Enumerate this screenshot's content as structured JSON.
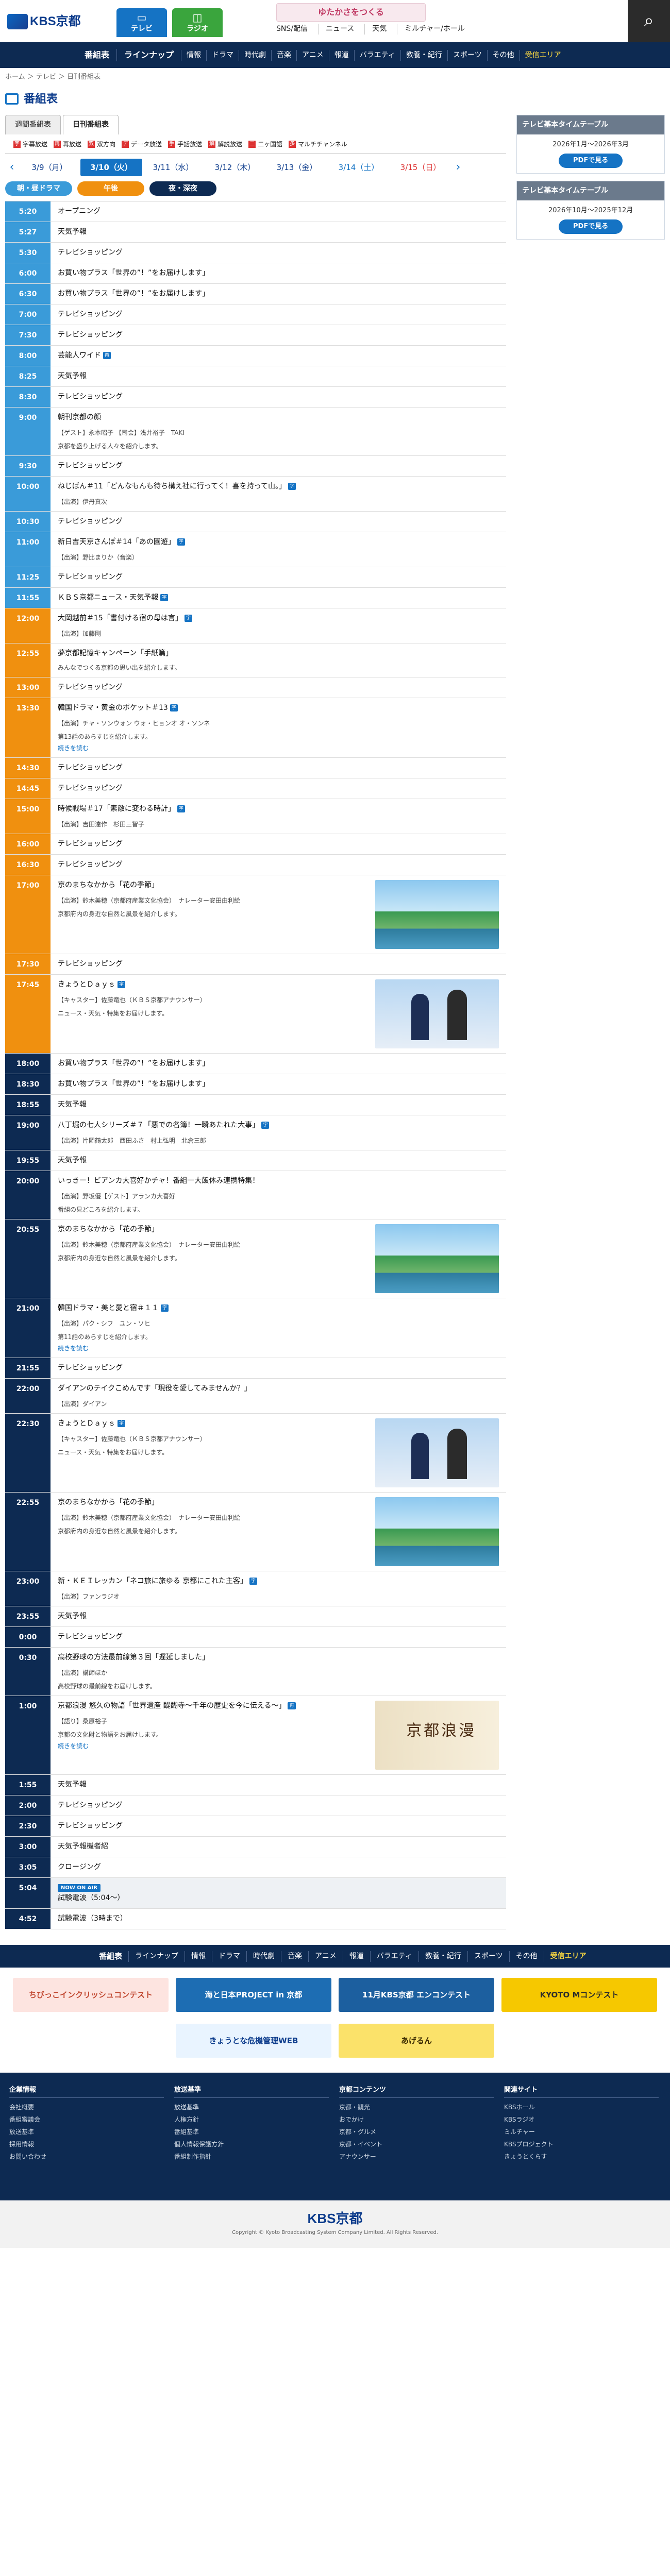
{
  "header": {
    "logo": "KBS京都",
    "tv_label": "テレビ",
    "radio_label": "ラジオ",
    "banner_text": "ゆたかさをつくる",
    "links": [
      "SNS/配信",
      "ニュース",
      "天気",
      "ミルチャー/ホール"
    ],
    "search_icon": "search-icon"
  },
  "gnav": [
    "番組表",
    "ラインナップ",
    "情報",
    "ドラマ",
    "時代劇",
    "音楽",
    "アニメ",
    "報道",
    "バラエティ",
    "教養・紀行",
    "スポーツ",
    "その他",
    "受信エリア"
  ],
  "breadcrumb": "ホーム ＞ テレビ ＞ 日刊番組表",
  "page_title": "番組表",
  "tabs": [
    "週間番組表",
    "日刊番組表"
  ],
  "legend": [
    {
      "mark": "字",
      "label": "字幕放送"
    },
    {
      "mark": "再",
      "label": "再放送"
    },
    {
      "mark": "双",
      "label": "双方向"
    },
    {
      "mark": "デ",
      "label": "データ放送"
    },
    {
      "mark": "手",
      "label": "手話放送"
    },
    {
      "mark": "解",
      "label": "解説放送"
    },
    {
      "mark": "二",
      "label": "二ヶ国語"
    },
    {
      "mark": "多",
      "label": "マルチチャンネル"
    }
  ],
  "dates": [
    {
      "label": "3/9（月）",
      "kind": ""
    },
    {
      "label": "3/10（火）",
      "kind": "on"
    },
    {
      "label": "3/11（水）",
      "kind": ""
    },
    {
      "label": "3/12（木）",
      "kind": ""
    },
    {
      "label": "3/13（金）",
      "kind": ""
    },
    {
      "label": "3/14（土）",
      "kind": "sat"
    },
    {
      "label": "3/15（日）",
      "kind": "sun"
    }
  ],
  "jumps": [
    "朝・昼ドラマ",
    "午後",
    "夜・深夜"
  ],
  "schedule": [
    {
      "time": "5:20",
      "zone": "morning",
      "title": "オープニング"
    },
    {
      "time": "5:27",
      "zone": "morning",
      "title": "天気予報"
    },
    {
      "time": "5:30",
      "zone": "morning",
      "title": "テレビショッピング"
    },
    {
      "time": "6:00",
      "zone": "morning",
      "title": "お買い物プラス「世界の”！”をお届けします」"
    },
    {
      "time": "6:30",
      "zone": "morning",
      "title": "お買い物プラス「世界の”！”をお届けします」"
    },
    {
      "time": "7:00",
      "zone": "morning",
      "title": "テレビショッピング"
    },
    {
      "time": "7:30",
      "zone": "morning",
      "title": "テレビショッピング"
    },
    {
      "time": "8:00",
      "zone": "morning",
      "title": "芸能人ワイド",
      "badge": "再"
    },
    {
      "time": "8:25",
      "zone": "morning",
      "title": "天気予報"
    },
    {
      "time": "8:30",
      "zone": "morning",
      "title": "テレビショッピング"
    },
    {
      "time": "9:00",
      "zone": "morning",
      "title": "朝刊京都の顔",
      "cast": "【ゲスト】永本昭子 【司会】浅井裕子　TAKI",
      "desc": "京都を盛り上げる人々を紹介します。"
    },
    {
      "time": "9:30",
      "zone": "morning",
      "title": "テレビショッピング"
    },
    {
      "time": "10:00",
      "zone": "morning",
      "title": "ねじばん＃11「どんなもんも待ち構え社に行ってく！喜を持って山。」",
      "badge": "字",
      "cast": "【出演】伊丹真次"
    },
    {
      "time": "10:30",
      "zone": "morning",
      "title": "テレビショッピング"
    },
    {
      "time": "11:00",
      "zone": "morning",
      "title": "新日吉天京さんぽ＃14「あの園遊」",
      "badge": "字",
      "cast": "【出演】野比まりか（音楽）"
    },
    {
      "time": "11:25",
      "zone": "morning",
      "title": "テレビショッピング"
    },
    {
      "time": "11:55",
      "zone": "morning",
      "title": "ＫＢＳ京都ニュース・天気予報",
      "badge": "字"
    },
    {
      "time": "12:00",
      "zone": "day",
      "title": "大岡越前＃15「書付ける宿の母は言」",
      "badge": "字",
      "cast": "【出演】加藤剛"
    },
    {
      "time": "12:55",
      "zone": "day",
      "title": "夢京都記憶キャンペーン「手紙篇」",
      "desc": "みんなでつくる京都の思い出を紹介します。"
    },
    {
      "time": "13:00",
      "zone": "day",
      "title": "テレビショッピング"
    },
    {
      "time": "13:30",
      "zone": "day",
      "title": "韓国ドラマ・黄金のポケット＃13",
      "badge": "字",
      "cast": "【出演】チャ・ソンウォン ウォ・ヒョンオ オ・ソンネ",
      "desc": "第13話のあらすじを紹介します。",
      "more": "続きを読む"
    },
    {
      "time": "14:30",
      "zone": "day",
      "title": "テレビショッピング"
    },
    {
      "time": "14:45",
      "zone": "day",
      "title": "テレビショッピング"
    },
    {
      "time": "15:00",
      "zone": "day",
      "title": "時候戦場＃17「素敵に変わる時計」",
      "badge": "字",
      "cast": "【出演】吉田達作　杉田三智子"
    },
    {
      "time": "16:00",
      "zone": "day",
      "title": "テレビショッピング"
    },
    {
      "time": "16:30",
      "zone": "day",
      "title": "テレビショッピング"
    },
    {
      "time": "17:00",
      "zone": "day",
      "title": "京のまちなかから「花の季節」",
      "cast": "【出演】鈴木美穂（京都府産業文化協会）　ナレーター安田由利絵",
      "desc": "京都府内の身近な自然と風景を紹介します。",
      "thumb": "river"
    },
    {
      "time": "17:30",
      "zone": "day",
      "title": "テレビショッピング"
    },
    {
      "time": "17:45",
      "zone": "day",
      "title": "きょうとＤａｙｓ",
      "badge": "字",
      "cast": "【キャスター】佐藤竜也（ＫＢＳ京都アナウンサー）",
      "desc": "ニュース・天気・特集をお届けします。",
      "thumb": "news"
    },
    {
      "time": "18:00",
      "zone": "night",
      "title": "お買い物プラス「世界の”！”をお届けします」"
    },
    {
      "time": "18:30",
      "zone": "night",
      "title": "お買い物プラス「世界の”！”をお届けします」"
    },
    {
      "time": "18:55",
      "zone": "night",
      "title": "天気予報"
    },
    {
      "time": "19:00",
      "zone": "night",
      "title": "八丁堀の七人シリーズ＃７「悪での名簿！一瞬あたれた大事」",
      "badge": "字",
      "cast": "【出演】片岡鶴太郎　西田ふさ　村上弘明　北倉三郎"
    },
    {
      "time": "19:55",
      "zone": "night",
      "title": "天気予報"
    },
    {
      "time": "20:00",
      "zone": "night",
      "title": "いっきー！ビアンカ大喜好かチャ！番組一大飯休み連携特集！",
      "cast": "【出演】野坂優【ゲスト】アランカ大喜好",
      "desc": "番組の見どころを紹介します。"
    },
    {
      "time": "20:55",
      "zone": "night",
      "title": "京のまちなかから「花の季節」",
      "cast": "【出演】鈴木美穂（京都府産業文化協会）　ナレーター安田由利絵",
      "desc": "京都府内の身近な自然と風景を紹介します。",
      "thumb": "river"
    },
    {
      "time": "21:00",
      "zone": "night",
      "title": "韓国ドラマ・美と愛と宿＃１１",
      "badge": "字",
      "cast": "【出演】パク・シフ　ユン・ソヒ",
      "desc": "第11話のあらすじを紹介します。",
      "more": "続きを読む"
    },
    {
      "time": "21:55",
      "zone": "night",
      "title": "テレビショッピング"
    },
    {
      "time": "22:00",
      "zone": "night",
      "title": "ダイアンのテイクこめんです「現役を愛してみませんか？」",
      "cast": "【出演】ダイアン"
    },
    {
      "time": "22:30",
      "zone": "night",
      "title": "きょうとＤａｙｓ",
      "badge": "字",
      "cast": "【キャスター】佐藤竜也（ＫＢＳ京都アナウンサー）",
      "desc": "ニュース・天気・特集をお届けします。",
      "thumb": "news"
    },
    {
      "time": "22:55",
      "zone": "night",
      "title": "京のまちなかから「花の季節」",
      "cast": "【出演】鈴木美穂（京都府産業文化協会）　ナレーター安田由利絵",
      "desc": "京都府内の身近な自然と風景を紹介します。",
      "thumb": "river"
    },
    {
      "time": "23:00",
      "zone": "night",
      "title": "新・ＫＥＩレッカン「ネコ旅に旅ゆる 京都にこれた主客」",
      "badge": "字",
      "cast": "【出演】ファンラジオ"
    },
    {
      "time": "23:55",
      "zone": "night",
      "title": "天気予報"
    },
    {
      "time": "0:00",
      "zone": "night",
      "title": "テレビショッピング"
    },
    {
      "time": "0:30",
      "zone": "night",
      "title": "高校野球の方法最前線第３回「遅延しました」",
      "cast": "【出演】講師ほか",
      "desc": "高校野球の最前線をお届けします。"
    },
    {
      "time": "1:00",
      "zone": "night",
      "title": "京都浪漫 悠久の物語「世界遺産 醍醐寺～千年の歴史を今に伝える～」",
      "badge": "再",
      "cast": "【語り】桑原裕子",
      "desc": "京都の文化財と物語をお届けします。",
      "more": "続きを読む",
      "thumb": "kyo"
    },
    {
      "time": "1:55",
      "zone": "night",
      "title": "天気予報"
    },
    {
      "time": "2:00",
      "zone": "night",
      "title": "テレビショッピング"
    },
    {
      "time": "2:30",
      "zone": "night",
      "title": "テレビショッピング"
    },
    {
      "time": "3:00",
      "zone": "night",
      "title": "天気予報機者紹"
    },
    {
      "time": "3:05",
      "zone": "night",
      "title": "クロージング"
    },
    {
      "time": "5:04",
      "zone": "night",
      "title": "試験電波（5:04〜）",
      "onair": "NOW ON AIR",
      "gray": true
    },
    {
      "time": "4:52",
      "zone": "night",
      "title": "試験電波（3時まで）"
    }
  ],
  "sidebar": [
    {
      "heading": "テレビ基本タイムテーブル",
      "period": "2026年1月〜2026年3月",
      "button": "PDFで見る"
    },
    {
      "heading": "テレビ基本タイムテーブル",
      "period": "2026年10月〜2025年12月",
      "button": "PDFで見る"
    }
  ],
  "footer": {
    "nav": [
      "番組表",
      "ラインナップ",
      "情報",
      "ドラマ",
      "時代劇",
      "音楽",
      "アニメ",
      "報道",
      "バラエティ",
      "教養・紀行",
      "スポーツ",
      "その他",
      "受信エリア"
    ],
    "banners": [
      "ちびっこインクリッシュコンテスト",
      "海と日本PROJECT in 京都",
      "11月KBS京都 エンコンテスト",
      "KYOTO Mコンテスト",
      "きょうとな危機管理WEB",
      "あげるん"
    ],
    "columns": [
      {
        "heading": "企業情報",
        "items": [
          "会社概要",
          "番組審議会",
          "放送基準",
          "採用情報",
          "お問い合わせ"
        ]
      },
      {
        "heading": "放送基準",
        "items": [
          "放送基準",
          "人権方針",
          "番組基準",
          "個人情報保護方針",
          "番組制作指針"
        ]
      },
      {
        "heading": "京都コンテンツ",
        "items": [
          "京都・観光",
          "おでかけ",
          "京都・グルメ",
          "京都・イベント",
          "アナウンサー"
        ]
      },
      {
        "heading": "関連サイト",
        "items": [
          "KBSホール",
          "KBSラジオ",
          "ミルチャー",
          "KBSプロジェクト",
          "きょうとくらす"
        ]
      }
    ],
    "logo": "KBS京都",
    "copyright": "Copyright © Kyoto Broadcasting System Company Limited. All Rights Reserved."
  }
}
